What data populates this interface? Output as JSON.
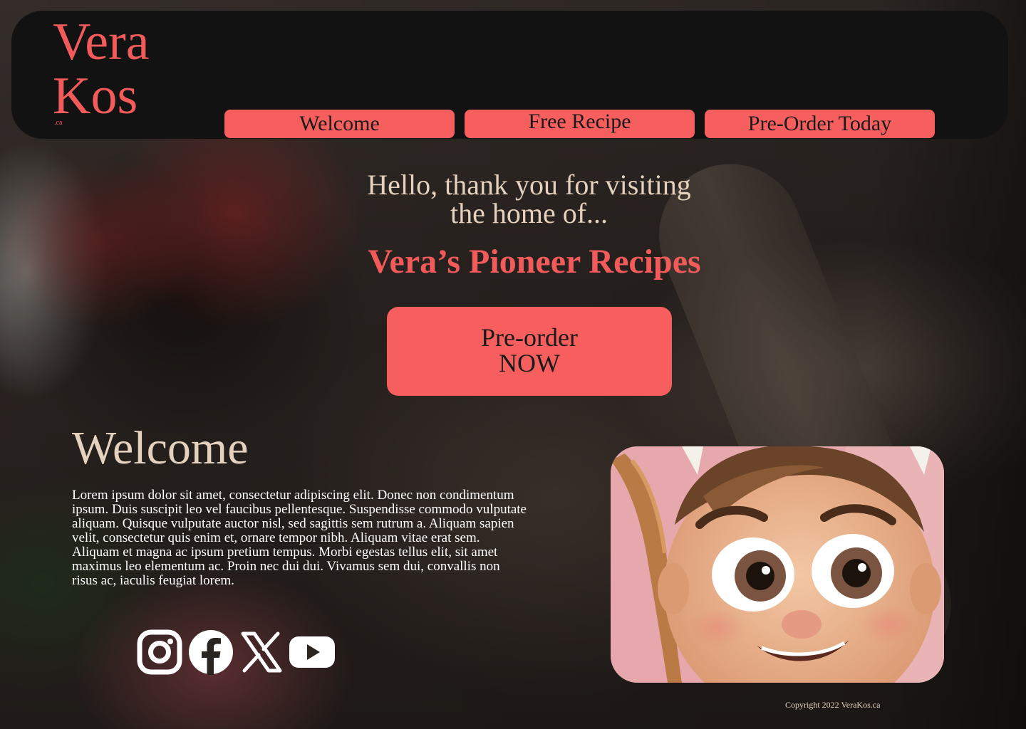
{
  "brand": {
    "logo_line1": "Vera",
    "logo_line2": "Kos",
    "logo_suffix": ".ca"
  },
  "nav": {
    "items": [
      {
        "label": "Welcome"
      },
      {
        "label": "Free Recipe"
      },
      {
        "label": "Pre-Order Today"
      }
    ]
  },
  "hero": {
    "greeting_line1": "Hello, thank you for visiting",
    "greeting_line2": "the home of...",
    "title": "Vera’s Pioneer Recipes",
    "cta_line1": "Pre-order",
    "cta_line2": "NOW"
  },
  "welcome": {
    "heading": "Welcome",
    "body": "Lorem ipsum dolor sit amet, consectetur adipiscing elit. Donec non condimentum ipsum. Duis suscipit leo vel faucibus pellentesque. Suspendisse commodo vulputate aliquam. Quisque vulputate auctor nisl, sed sagittis sem rutrum a. Aliquam sapien velit, consectetur quis enim et, ornare tempor nibh. Aliquam vitae erat sem. Aliquam et magna ac ipsum pretium tempus. Morbi egestas tellus elit, sit amet maximus leo elementum ac. Proin nec dui dui. Vivamus sem dui, convallis non risus ac, iaculis feugiat lorem."
  },
  "social": {
    "icons": [
      "instagram-icon",
      "facebook-icon",
      "x-icon",
      "youtube-icon"
    ]
  },
  "footer": {
    "copyright": "Copyright 2022 VeraKos.ca"
  },
  "colors": {
    "accent": "#f75f5f",
    "logo": "#f35a5a",
    "header_bg": "#121212",
    "cream_text": "#e4d2bf"
  }
}
